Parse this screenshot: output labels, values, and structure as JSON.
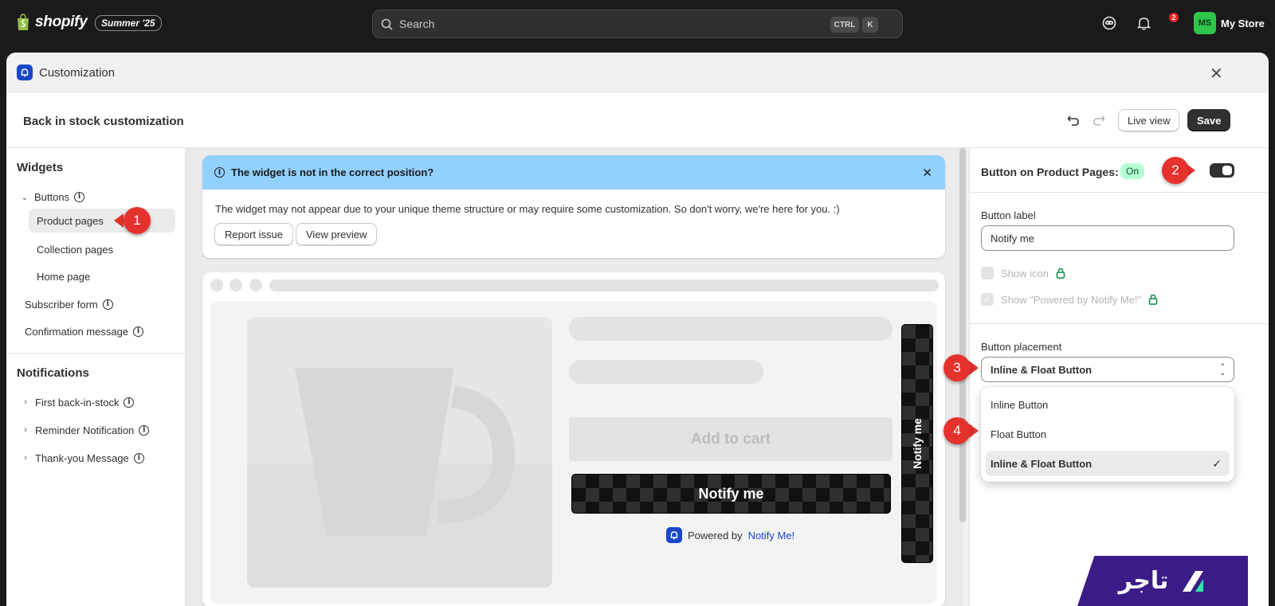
{
  "topbar": {
    "brand": "shopify",
    "edition": "Summer '25",
    "search_placeholder": "Search",
    "shortcut_1": "CTRL",
    "shortcut_2": "K",
    "notification_count": "2",
    "avatar_initials": "MS",
    "store_name": "My Store"
  },
  "modal": {
    "title": "Customization",
    "page_title": "Back in stock customization",
    "live_view_label": "Live view",
    "save_label": "Save"
  },
  "sidebar": {
    "widgets_title": "Widgets",
    "buttons_label": "Buttons",
    "product_pages": "Product pages",
    "collection_pages": "Collection pages",
    "home_page": "Home page",
    "subscriber_form": "Subscriber form",
    "confirmation_message": "Confirmation message",
    "notifications_title": "Notifications",
    "first_back_in_stock": "First back-in-stock",
    "reminder_notification": "Reminder Notification",
    "thank_you_message": "Thank-you Message"
  },
  "banner": {
    "title": "The widget is not in the correct position?",
    "text": "The widget may not appear due to your unique theme structure or may require some customization. So don't worry, we're here for you. :)",
    "report_label": "Report issue",
    "preview_label": "View preview"
  },
  "preview": {
    "add_to_cart": "Add to cart",
    "notify_label": "Notify me",
    "powered_prefix": "Powered by",
    "powered_link": "Notify Me!",
    "float_label": "Notify me"
  },
  "panel": {
    "title": "Button on Product Pages:",
    "status": "On",
    "button_label_title": "Button label",
    "button_label_value": "Notify me",
    "show_icon": "Show icon",
    "show_powered": "Show \"Powered by Notify Me!\"",
    "placement_title": "Button placement",
    "placement_value": "Inline & Float Button",
    "options": [
      "Inline Button",
      "Float Button",
      "Inline & Float Button"
    ]
  },
  "markers": [
    "1",
    "2",
    "3",
    "4"
  ],
  "watermark": "تاجر",
  "colors": {
    "accent_blue": "#1847c9",
    "marker_red": "#e5322d",
    "banner_blue": "#91d0ff",
    "on_badge": "#b4fed2",
    "brand_purple": "#3b1c87"
  }
}
